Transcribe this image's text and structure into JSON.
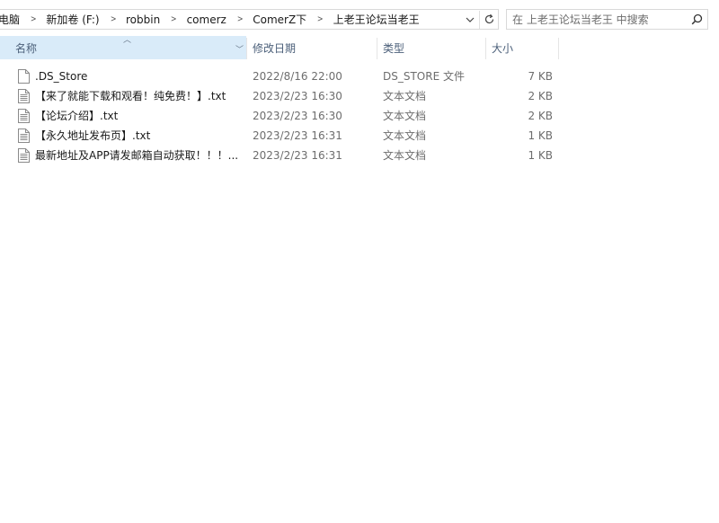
{
  "breadcrumb": {
    "items": [
      "电脑",
      "新加卷 (F:)",
      "robbin",
      "comerz",
      "ComerZ下",
      "上老王论坛当老王"
    ]
  },
  "search": {
    "placeholder": "在 上老王论坛当老王 中搜索"
  },
  "columns": {
    "name": "名称",
    "date": "修改日期",
    "type": "类型",
    "size": "大小"
  },
  "files": [
    {
      "name": ".DS_Store",
      "date": "2022/8/16 22:00",
      "type": "DS_STORE 文件",
      "size": "7 KB",
      "icon": "blank-file-icon"
    },
    {
      "name": "【来了就能下载和观看！纯免费！】.txt",
      "date": "2023/2/23 16:30",
      "type": "文本文档",
      "size": "2 KB",
      "icon": "text-file-icon"
    },
    {
      "name": "【论坛介绍】.txt",
      "date": "2023/2/23 16:30",
      "type": "文本文档",
      "size": "2 KB",
      "icon": "text-file-icon"
    },
    {
      "name": "【永久地址发布页】.txt",
      "date": "2023/2/23 16:31",
      "type": "文本文档",
      "size": "1 KB",
      "icon": "text-file-icon"
    },
    {
      "name": "最新地址及APP请发邮箱自动获取！！！...",
      "date": "2023/2/23 16:31",
      "type": "文本文档",
      "size": "1 KB",
      "icon": "text-file-icon"
    }
  ]
}
